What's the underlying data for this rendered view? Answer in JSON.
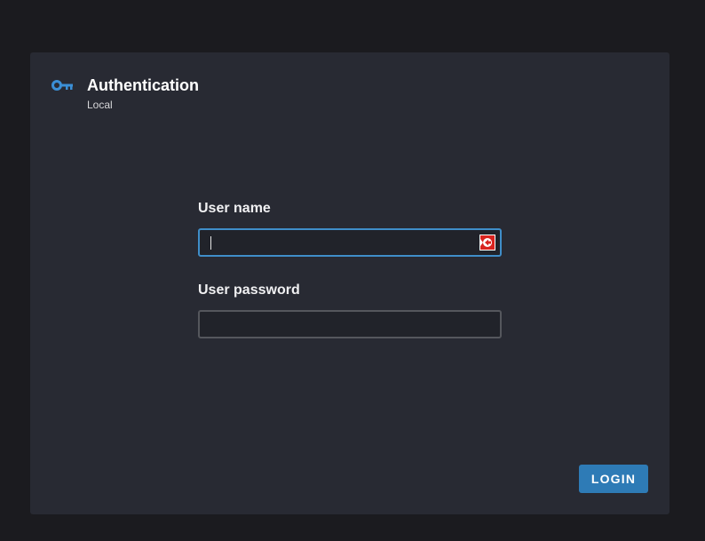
{
  "dialog": {
    "title": "Authentication",
    "subtitle": "Local",
    "icon": "key-icon"
  },
  "form": {
    "username": {
      "label": "User name",
      "value": "",
      "placeholder": "",
      "focused": true
    },
    "password": {
      "label": "User password",
      "value": "",
      "placeholder": ""
    }
  },
  "actions": {
    "login_label": "LOGIN"
  },
  "colors": {
    "page_background": "#1b1b1f",
    "dialog_background": "#282a33",
    "accent": "#2e7bb6",
    "focus_border": "#3f8ec9",
    "icon_blue": "#3b8fd6"
  }
}
